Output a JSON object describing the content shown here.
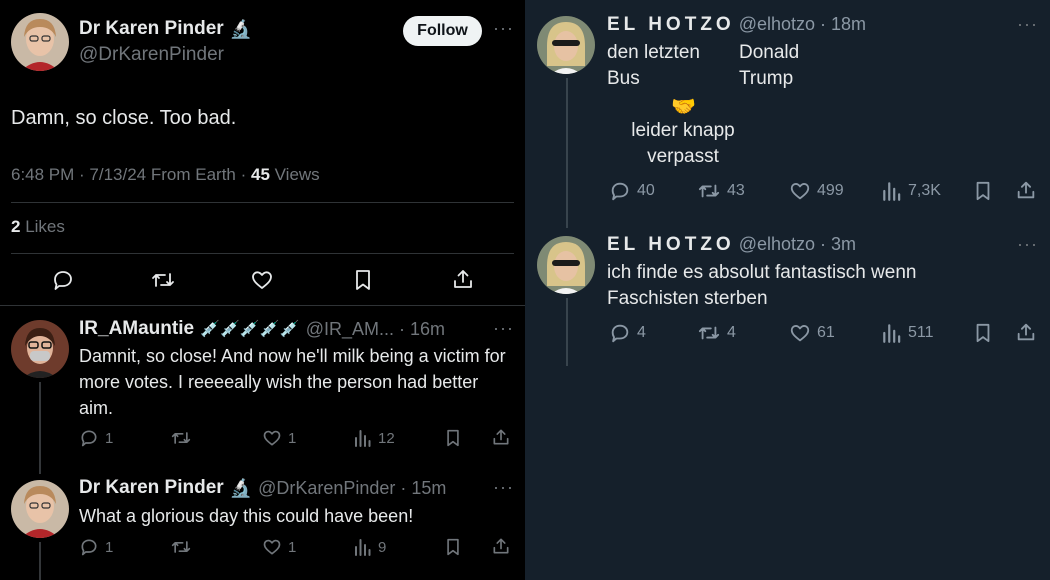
{
  "left": {
    "main_tweet": {
      "name": "Dr Karen Pinder",
      "badge_icon": "microscope-icon",
      "handle": "@DrKarenPinder",
      "follow_label": "Follow",
      "text": "Damn, so close. Too bad.",
      "meta_time": "6:48 PM · 7/13/24 From Earth · ",
      "views_count": "45",
      "views_label": " Views",
      "likes_count": "2",
      "likes_label": " Likes"
    },
    "reply1": {
      "name": "IR_AMauntie",
      "name_emojis": "💉💉💉💉💉",
      "handle_time": "@IR_AM... · 16m",
      "text": "Damnit, so close! And now he'll milk being a victim for more votes. I reeeeally wish the person had better aim.",
      "replies": "1",
      "reposts": "",
      "likes": "1",
      "views": "12"
    },
    "reply2": {
      "name": "Dr Karen Pinder",
      "badge_icon": "microscope-icon",
      "handle_time": "@DrKarenPinder · 15m",
      "text": "What a glorious day this could have been!",
      "replies": "1",
      "reposts": "",
      "likes": "1",
      "views": "9"
    }
  },
  "right": {
    "tweet1": {
      "name": "EL HOTZO",
      "handle_time": "@elhotzo · 18m",
      "left_word1": "den letzten",
      "left_word2": "Bus",
      "right_word1": "Donald",
      "right_word2": "Trump",
      "emoji": "🤝",
      "caption1": "leider knapp",
      "caption2": "verpasst",
      "replies": "40",
      "reposts": "43",
      "likes": "499",
      "views": "7,3K"
    },
    "tweet2": {
      "name": "EL HOTZO",
      "handle_time": "@elhotzo · 3m",
      "text_line1": "ich finde es absolut fantastisch wenn",
      "text_line2": "Faschisten sterben",
      "replies": "4",
      "reposts": "4",
      "likes": "61",
      "views": "511"
    }
  },
  "colors": {
    "left_bg": "#000000",
    "right_bg": "#15202b",
    "text": "#e7e9ea",
    "muted": "#71767b",
    "follow_bg": "#eff3f4"
  }
}
